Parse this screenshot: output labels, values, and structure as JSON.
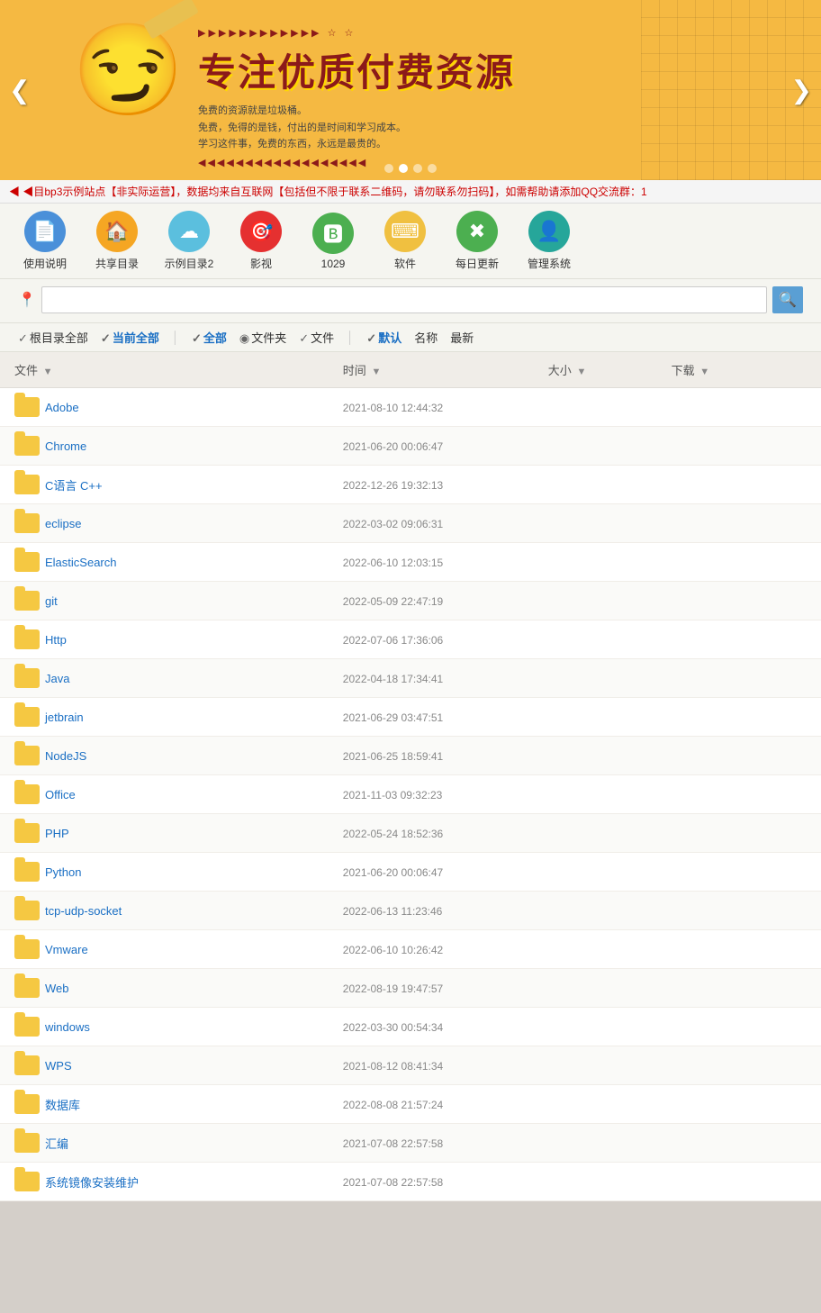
{
  "banner": {
    "title": "专注优质付费资源",
    "sub_lines": [
      "免费的资源就是垃圾桶。",
      "免费，免得的是钱，付出的是时间和学习成本。",
      "学习这件事，免费的东西，永远是最贵的。"
    ],
    "arrow_left": "❮",
    "arrow_right": "❯"
  },
  "notice": {
    "text": "◀目bp3示例站点【非实际运营】，数据均来自互联网【包括但不限于联系二维码，请勿联系勿扫码】，如需帮助请添加QQ交流群：1"
  },
  "nav": {
    "items": [
      {
        "id": "usage",
        "label": "使用说明",
        "icon": "📄",
        "color": "blue"
      },
      {
        "id": "shared",
        "label": "共享目录",
        "icon": "🏠",
        "color": "orange"
      },
      {
        "id": "example2",
        "label": "示例目录2",
        "icon": "☁",
        "color": "cyan"
      },
      {
        "id": "video",
        "label": "影视",
        "icon": "🎯",
        "color": "red"
      },
      {
        "id": "1029",
        "label": "1029",
        "icon": "🅱",
        "color": "green"
      },
      {
        "id": "software",
        "label": "软件",
        "icon": "💻",
        "color": "yellow"
      },
      {
        "id": "daily",
        "label": "每日更新",
        "icon": "✖",
        "color": "green"
      },
      {
        "id": "admin",
        "label": "管理系统",
        "icon": "👤",
        "color": "teal"
      }
    ]
  },
  "search": {
    "placeholder": "",
    "pin_icon": "📍",
    "search_icon": "🔍"
  },
  "filters": {
    "root": "根目录全部",
    "current": "当前全部",
    "all": "全部",
    "folder": "文件夹",
    "file": "文件",
    "default": "默认",
    "name": "名称",
    "latest": "最新"
  },
  "table": {
    "headers": {
      "file": "文件",
      "time": "时间",
      "size": "大小",
      "download": "下载"
    },
    "rows": [
      {
        "name": "Adobe",
        "date": "2021-08-10 12:44:32",
        "size": "",
        "download": ""
      },
      {
        "name": "Chrome",
        "date": "2021-06-20 00:06:47",
        "size": "",
        "download": ""
      },
      {
        "name": "C语言 C++",
        "date": "2022-12-26 19:32:13",
        "size": "",
        "download": ""
      },
      {
        "name": "eclipse",
        "date": "2022-03-02 09:06:31",
        "size": "",
        "download": ""
      },
      {
        "name": "ElasticSearch",
        "date": "2022-06-10 12:03:15",
        "size": "",
        "download": ""
      },
      {
        "name": "git",
        "date": "2022-05-09 22:47:19",
        "size": "",
        "download": ""
      },
      {
        "name": "Http",
        "date": "2022-07-06 17:36:06",
        "size": "",
        "download": ""
      },
      {
        "name": "Java",
        "date": "2022-04-18 17:34:41",
        "size": "",
        "download": ""
      },
      {
        "name": "jetbrain",
        "date": "2021-06-29 03:47:51",
        "size": "",
        "download": ""
      },
      {
        "name": "NodeJS",
        "date": "2021-06-25 18:59:41",
        "size": "",
        "download": ""
      },
      {
        "name": "Office",
        "date": "2021-11-03 09:32:23",
        "size": "",
        "download": ""
      },
      {
        "name": "PHP",
        "date": "2022-05-24 18:52:36",
        "size": "",
        "download": ""
      },
      {
        "name": "Python",
        "date": "2021-06-20 00:06:47",
        "size": "",
        "download": ""
      },
      {
        "name": "tcp-udp-socket",
        "date": "2022-06-13 11:23:46",
        "size": "",
        "download": ""
      },
      {
        "name": "Vmware",
        "date": "2022-06-10 10:26:42",
        "size": "",
        "download": ""
      },
      {
        "name": "Web",
        "date": "2022-08-19 19:47:57",
        "size": "",
        "download": ""
      },
      {
        "name": "windows",
        "date": "2022-03-30 00:54:34",
        "size": "",
        "download": ""
      },
      {
        "name": "WPS",
        "date": "2021-08-12 08:41:34",
        "size": "",
        "download": ""
      },
      {
        "name": "数据库",
        "date": "2022-08-08 21:57:24",
        "size": "",
        "download": ""
      },
      {
        "name": "汇编",
        "date": "2021-07-08 22:57:58",
        "size": "",
        "download": ""
      },
      {
        "name": "系统镜像安装维护",
        "date": "2021-07-08 22:57:58",
        "size": "",
        "download": ""
      }
    ]
  },
  "colors": {
    "link": "#1a6fc4",
    "date": "#888888",
    "header_bg": "#f0ede8",
    "notice_text": "#cc0000",
    "folder_yellow": "#f5c842"
  }
}
